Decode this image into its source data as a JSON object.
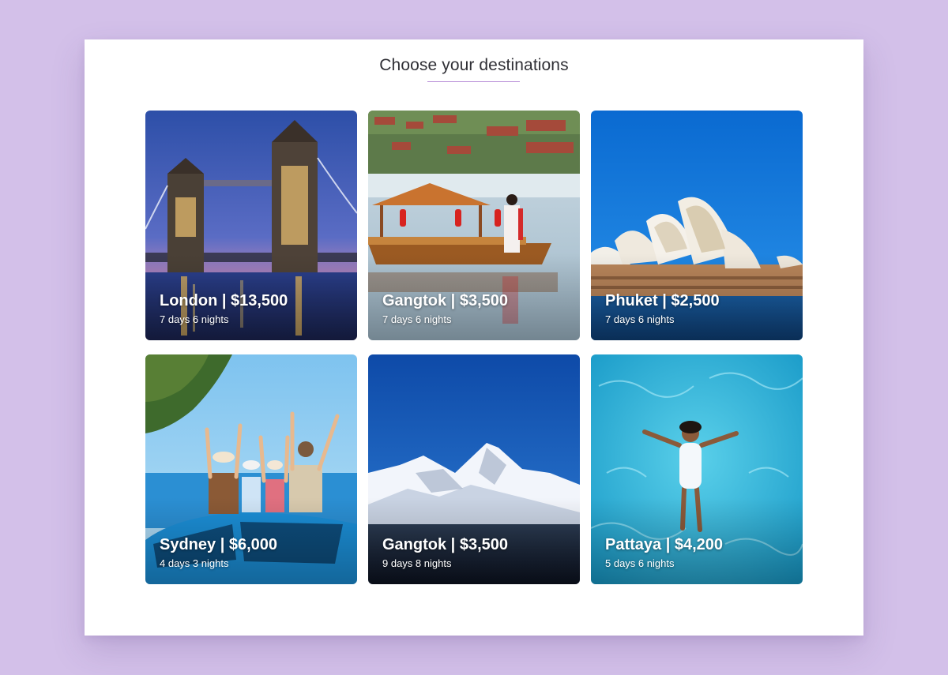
{
  "page": {
    "title": "Choose your destinations",
    "colors": {
      "background": "#d3c0e9",
      "panel": "#ffffff",
      "accent_rule": "#b58ad6",
      "title_text": "#2f2f35"
    }
  },
  "destinations": [
    {
      "name": "London",
      "price": "$13,500",
      "title": "London | $13,500",
      "duration": "7 days 6 nights",
      "scene": "tower-bridge-night"
    },
    {
      "name": "Gangtok",
      "price": "$3,500",
      "title": "Gangtok | $3,500",
      "duration": "7 days 6 nights",
      "scene": "lake-pavilion-boat"
    },
    {
      "name": "Phuket",
      "price": "$2,500",
      "title": "Phuket | $2,500",
      "duration": "7 days 6 nights",
      "scene": "sydney-opera-house"
    },
    {
      "name": "Sydney",
      "price": "$6,000",
      "title": "Sydney | $6,000",
      "duration": "4 days 3 nights",
      "scene": "family-on-car-by-sea"
    },
    {
      "name": "Gangtok",
      "price": "$3,500",
      "title": "Gangtok | $3,500",
      "duration": "9 days 8 nights",
      "scene": "snowy-mountain"
    },
    {
      "name": "Pattaya",
      "price": "$4,200",
      "title": "Pattaya | $4,200",
      "duration": "5 days 6 nights",
      "scene": "woman-floating-in-pool"
    }
  ]
}
